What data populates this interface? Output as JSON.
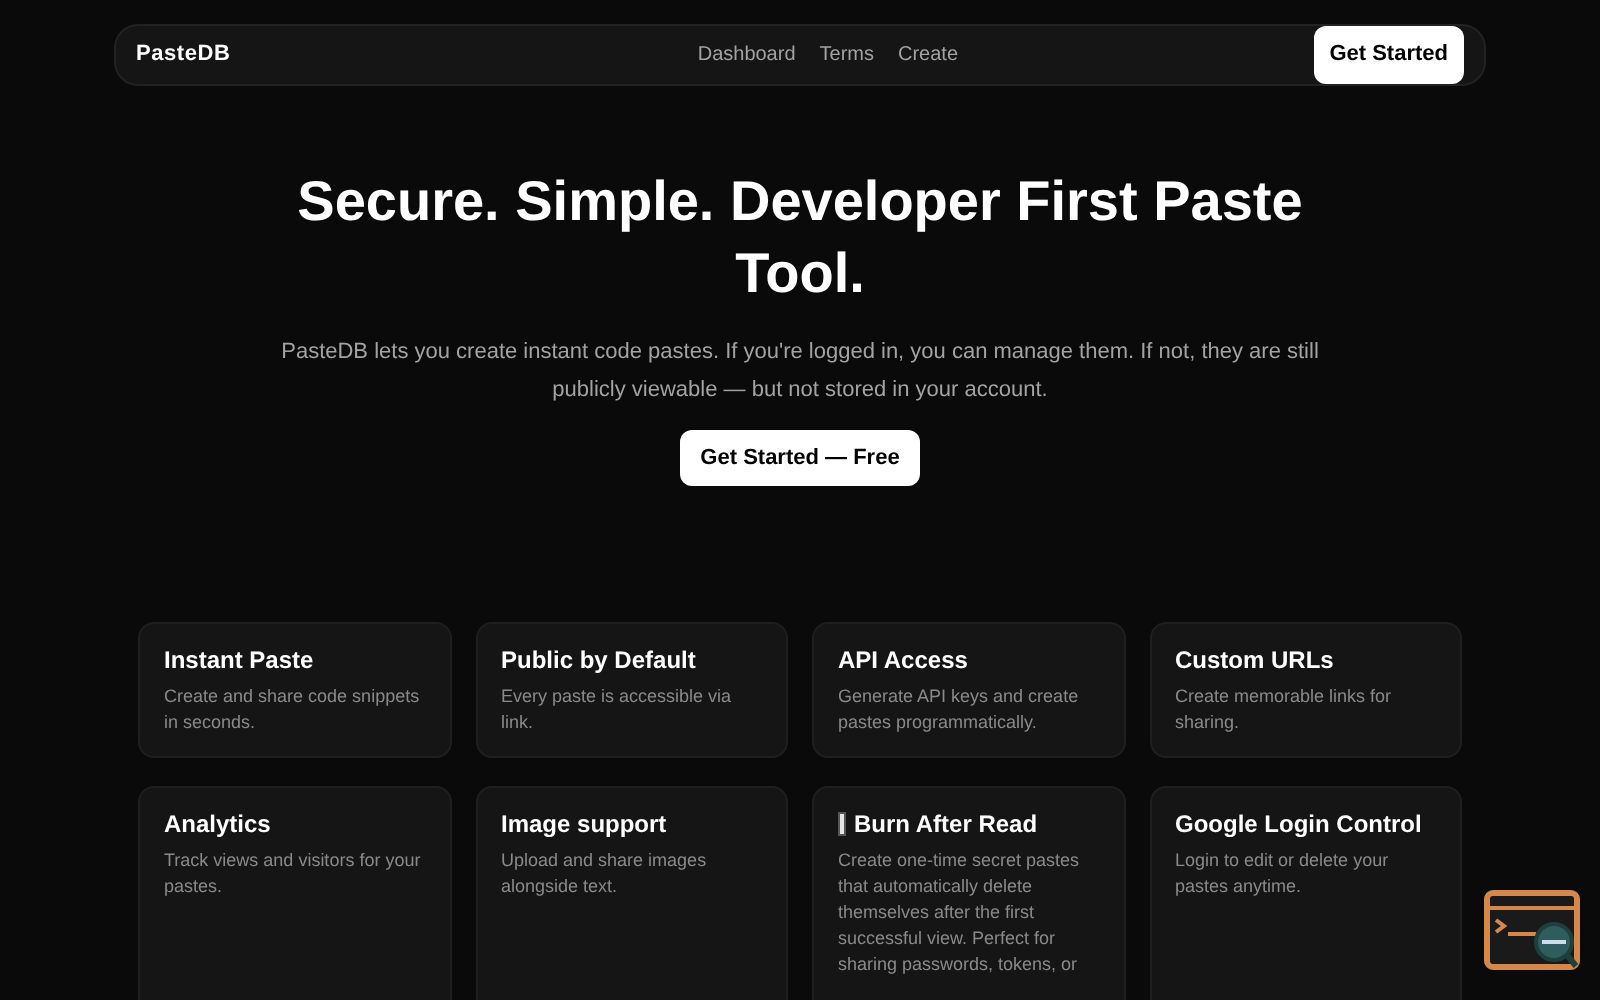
{
  "nav": {
    "brand": "PasteDB",
    "links": [
      "Dashboard",
      "Terms",
      "Create"
    ],
    "cta": "Get Started"
  },
  "hero": {
    "title": "Secure. Simple. Developer First Paste Tool.",
    "subtitle": "PasteDB lets you create instant code pastes. If you're logged in, you can manage them. If not, they are still publicly viewable — but not stored in your account.",
    "cta": "Get Started — Free"
  },
  "features": [
    {
      "title": "Instant Paste",
      "description": "Create and share code snippets in seconds."
    },
    {
      "title": "Public by Default",
      "description": "Every paste is accessible via link."
    },
    {
      "title": "API Access",
      "description": "Generate API keys and create pastes programmatically."
    },
    {
      "title": "Custom URLs",
      "description": "Create memorable links for sharing."
    },
    {
      "title": "Analytics",
      "description": "Track views and visitors for your pastes."
    },
    {
      "title": "Image support",
      "description": "Upload and share images alongside text."
    },
    {
      "title": "Burn After Read",
      "icon": true,
      "description": "Create one-time secret pastes that automatically delete themselves after the first successful view. Perfect for sharing passwords, tokens, or"
    },
    {
      "title": "Google Login Control",
      "description": "Login to edit or delete your pastes anytime."
    }
  ]
}
